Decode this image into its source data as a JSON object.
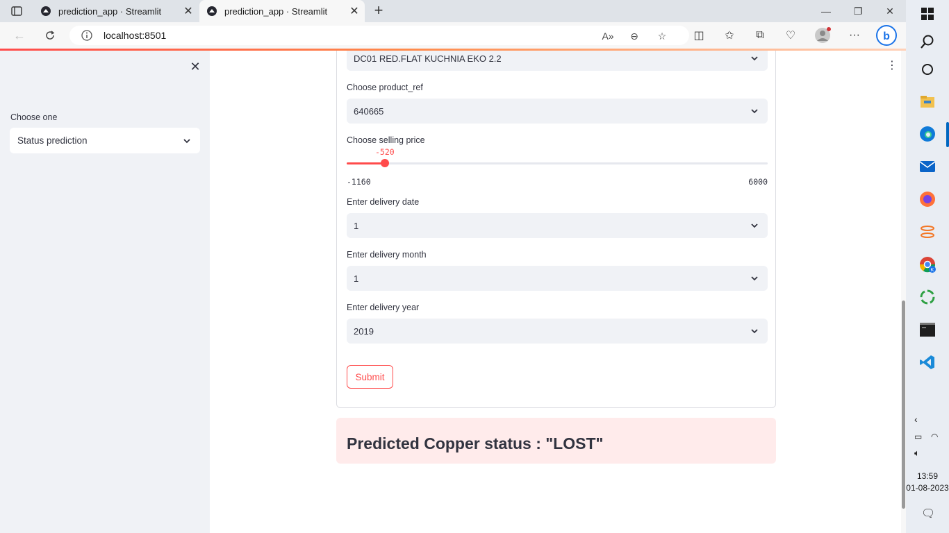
{
  "browser": {
    "tabs": [
      {
        "title": "prediction_app · Streamlit",
        "active": false
      },
      {
        "title": "prediction_app · Streamlit",
        "active": true
      }
    ],
    "url": "localhost:8501"
  },
  "sidebar": {
    "label": "Choose one",
    "selected": "Status prediction"
  },
  "form": {
    "item_select_value": "DC01 RED.FLAT KUCHNIA EKO 2.2",
    "product_ref": {
      "label": "Choose product_ref",
      "value": "640665"
    },
    "selling_price": {
      "label": "Choose selling price",
      "value": "-520",
      "min": "-1160",
      "max": "6000",
      "fill_fraction": 0.09
    },
    "delivery_date": {
      "label": "Enter delivery date",
      "value": "1"
    },
    "delivery_month": {
      "label": "Enter delivery month",
      "value": "1"
    },
    "delivery_year": {
      "label": "Enter delivery year",
      "value": "2019"
    },
    "submit_label": "Submit"
  },
  "result": {
    "text": "Predicted Copper status : \"LOST\""
  },
  "taskbar": {
    "time": "13:59",
    "date": "01-08-2023"
  },
  "colors": {
    "accent": "#ff4b4b",
    "sidebar_bg": "#f0f2f6",
    "result_bg": "#ffebeb"
  }
}
